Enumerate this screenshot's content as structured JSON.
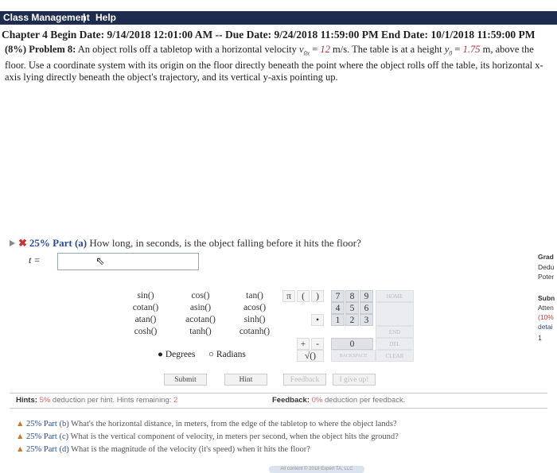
{
  "nav": {
    "class_management": "Class Management",
    "separator": "|",
    "help": "Help"
  },
  "dates": {
    "line": "Chapter 4 Begin Date: 9/14/2018 12:01:00 AM -- Due Date: 9/24/2018 11:59:00 PM End Date: 10/1/2018 11:59:00 PM"
  },
  "problem": {
    "prefix": "(8%) Problem 8:",
    "text1": " An object rolls off a tabletop with a horizontal velocity ",
    "v_var": "v",
    "v_sub": "0x",
    "eq1": " = ",
    "v_val": "12",
    "v_unit": " m/s. The table is at a height ",
    "y_var": "y",
    "y_sub": "0",
    "eq2": " = ",
    "y_val": "1.75",
    "text2": " m, above the floor. Use a coordinate system with its origin on the floor directly beneath the point where the object rolls off the table, its horizontal x-axis lying directly beneath the object's trajectory, and its vertical y-axis pointing up."
  },
  "part_a": {
    "percent": "25% Part (a)",
    "question": "How long, in seconds, is the object falling before it hits the floor?",
    "input_label": "t =",
    "input_value": ""
  },
  "side": {
    "grade": "Grad",
    "deduct": "Dedu",
    "potential": "Poter",
    "submissions": "Subn",
    "attempts": "Atten",
    "pct": "(10%",
    "detail": "detai",
    "count": "1"
  },
  "calculator": {
    "fn_col1": [
      "sin()",
      "cotan()",
      "atan()",
      "cosh()"
    ],
    "fn_col2": [
      "cos()",
      "asin()",
      "acotan()",
      "tanh()"
    ],
    "fn_col3": [
      "tan()",
      "acos()",
      "sinh()",
      "cotanh()"
    ],
    "pi": "π",
    "lparen": "(",
    "rparen": ")",
    "digits_row1": [
      "7",
      "8",
      "9"
    ],
    "digits_row2": [
      "4",
      "5",
      "6"
    ],
    "digits_row3": [
      "1",
      "2",
      "3"
    ],
    "zero": "0",
    "dot": "•",
    "plus": "+",
    "minus": "-",
    "sqrt": "√()",
    "home": "HOME",
    "end": "END",
    "backspace": "BACKSPACE",
    "del": "DEL",
    "clear": "CLEAR",
    "degrees": "Degrees",
    "radians": "Radians"
  },
  "buttons": {
    "submit": "Submit",
    "hint": "Hint",
    "feedback": "Feedback",
    "give_up": "I give up!"
  },
  "hints": {
    "label": "Hints:",
    "pct": "5%",
    "text": " deduction per hint. Hints remaining: ",
    "remaining": "2"
  },
  "feedback": {
    "label": "Feedback:",
    "pct": "0%",
    "text": " deduction per feedback."
  },
  "other_parts": [
    {
      "pct": "25% Part (b)",
      "text": " What's the horizontal distance, in meters, from the edge of the tabletop to where the object lands?"
    },
    {
      "pct": "25% Part (c)",
      "text": " What is the vertical component of velocity, in meters per second, when the object hits the ground?"
    },
    {
      "pct": "25% Part (d)",
      "text": " What is the magnitude of the velocity (it's speed) when it hits the floor?"
    }
  ],
  "footer": {
    "copyright": "All content © 2018 Expert TA, LLC"
  }
}
